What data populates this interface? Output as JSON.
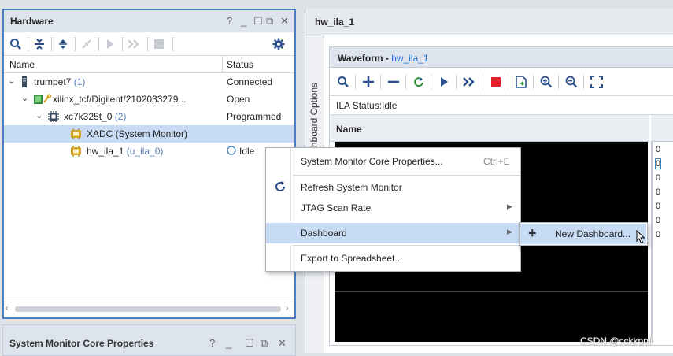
{
  "hardware_panel": {
    "title": "Hardware",
    "controls": {
      "help": "?",
      "minimize": "_",
      "maximize": "☐",
      "restore": "⧉",
      "close": "✕"
    },
    "columns": {
      "name": "Name",
      "status": "Status"
    },
    "rows": [
      {
        "name": "trumpet7",
        "count": "(1)",
        "status": "Connected",
        "icon": "server-icon"
      },
      {
        "name": "xilinx_tcf/Digilent/2102033279...",
        "status": "Open",
        "icon": "jtag-target-icon"
      },
      {
        "name": "xc7k325t_0",
        "count": "(2)",
        "status": "Programmed",
        "icon": "fpga-chip-icon"
      },
      {
        "name": "XADC (System Monitor)",
        "status": "",
        "icon": "debug-core-icon"
      },
      {
        "name": "hw_ila_1",
        "suffix": "(u_ila_0)",
        "status": "Idle",
        "icon": "debug-core-icon"
      }
    ]
  },
  "bottom_panel": {
    "title": "System Monitor Core Properties",
    "controls": {
      "help": "?",
      "minimize": "_",
      "maximize": "☐",
      "restore": "⧉",
      "close": "✕"
    }
  },
  "right_panel": {
    "tab_title": "hw_ila_1",
    "vertical_tab": "Dashboard Options",
    "waveform": {
      "title": "Waveform - ",
      "title_link": "hw_ila_1",
      "ila_status": "ILA Status:Idle",
      "name_header": "Name",
      "right_digits": [
        "0",
        "0",
        "0",
        "0",
        "0",
        "0",
        "0"
      ]
    }
  },
  "context_menu": {
    "items": [
      {
        "label": "System Monitor Core Properties...",
        "shortcut": "Ctrl+E"
      },
      {
        "label": "Refresh System Monitor",
        "icon": "refresh-icon"
      },
      {
        "label": "JTAG Scan Rate",
        "submenu": true
      },
      {
        "label": "Dashboard",
        "submenu": true,
        "highlighted": true
      },
      {
        "label": "Export to Spreadsheet..."
      }
    ]
  },
  "submenu": {
    "label": "New Dashboard...",
    "icon": "plus-icon"
  },
  "watermark": "CSDN @cckkppll",
  "colors": {
    "accent": "#1c6fd1",
    "selection": "#c7dcf4",
    "panel_border": "#4a7fc1"
  }
}
